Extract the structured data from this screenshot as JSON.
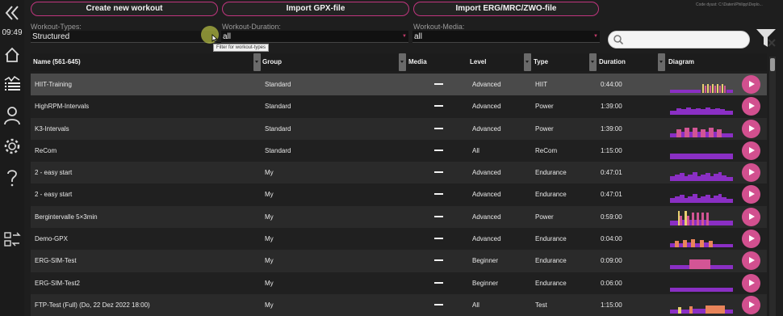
{
  "sidebar": {
    "clock": "09:49",
    "icons": [
      "collapse-icon",
      "home-icon",
      "workouts-icon",
      "profile-icon",
      "settings-icon",
      "help-icon",
      "sync-icon"
    ]
  },
  "toolbar": {
    "create_label": "Create new workout",
    "import_gpx_label": "Import GPX-file",
    "import_erg_label": "Import ERG/MRC/ZWO-file",
    "code_dir": "Code dyust: C:\\Daten\\Philipp\\Deplo..."
  },
  "filters": {
    "types_label": "Workout-Types:",
    "types_value": "Structured",
    "duration_label": "Workout-Duration:",
    "duration_value": "all",
    "media_label": "Workout-Media:",
    "media_value": "all",
    "tooltip": "Filter for workout-types",
    "search_placeholder": ""
  },
  "colors": {
    "accent": "#c0357e",
    "play": "#d2508f",
    "diagram_purple": "#8a2fc4",
    "diagram_pink": "#d25595",
    "diagram_orange": "#e8845a",
    "diagram_yellow": "#e8d070"
  },
  "table": {
    "headers": {
      "name": "Name (561-645)",
      "group": "Group",
      "media": "Media",
      "level": "Level",
      "type": "Type",
      "duration": "Duration",
      "diagram": "Diagram"
    },
    "rows": [
      {
        "name": "HIIT-Training",
        "group": "Standard",
        "level": "Advanced",
        "type": "HIIT",
        "duration": "0:44:00",
        "diagram": "hiit"
      },
      {
        "name": "HighRPM-Intervals",
        "group": "Standard",
        "level": "Advanced",
        "type": "Power",
        "duration": "1:39:00",
        "diagram": "highrpm"
      },
      {
        "name": "K3-Intervals",
        "group": "Standard",
        "level": "Advanced",
        "type": "Power",
        "duration": "1:39:00",
        "diagram": "k3"
      },
      {
        "name": "ReCom",
        "group": "Standard",
        "level": "All",
        "type": "ReCom",
        "duration": "1:15:00",
        "diagram": "recom"
      },
      {
        "name": "2 - easy start",
        "group": "My",
        "level": "Advanced",
        "type": "Endurance",
        "duration": "0:47:01",
        "diagram": "easy"
      },
      {
        "name": "2 - easy start",
        "group": "My",
        "level": "Advanced",
        "type": "Endurance",
        "duration": "0:47:01",
        "diagram": "easy"
      },
      {
        "name": "Bergintervalle 5×3min",
        "group": "My",
        "level": "Advanced",
        "type": "Power",
        "duration": "0:59:00",
        "diagram": "berg"
      },
      {
        "name": "Demo-GPX",
        "group": "My",
        "level": "Advanced",
        "type": "Endurance",
        "duration": "0:04:00",
        "diagram": "gpx"
      },
      {
        "name": "ERG-SIM-Test",
        "group": "My",
        "level": "Beginner",
        "type": "Endurance",
        "duration": "0:09:00",
        "diagram": "erg1"
      },
      {
        "name": "ERG-SIM-Test2",
        "group": "My",
        "level": "Beginner",
        "type": "Endurance",
        "duration": "0:06:00",
        "diagram": "erg2"
      },
      {
        "name": "FTP-Test (Full) (Do, 22 Dez 2022 18:00)",
        "group": "My",
        "level": "All",
        "type": "Test",
        "duration": "1:15:00",
        "diagram": "ftp"
      }
    ]
  }
}
